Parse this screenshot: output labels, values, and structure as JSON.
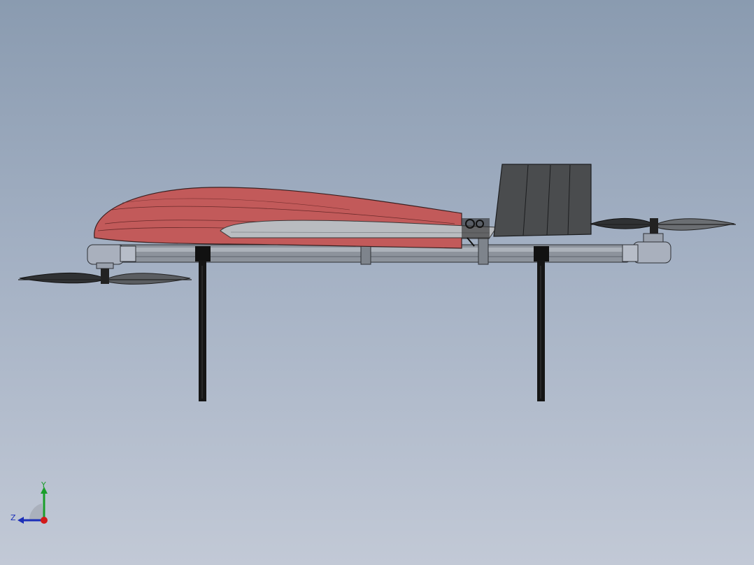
{
  "viewport": {
    "background_top": "#8a9bb0",
    "background_bottom": "#c2c9d6"
  },
  "model": {
    "wing_color": "#c25a5a",
    "fin_color": "#4a4c4e",
    "boom_color": "#8d939c",
    "strut_color": "#151515",
    "propeller_color": "#3b3d3f",
    "motor_pod_color": "#a9b0bd"
  },
  "triad": {
    "y_label": "Y",
    "z_label": "Z",
    "y_color": "#1a9e2a",
    "z_color": "#1c2fb8",
    "x_color": "#d21a1a"
  }
}
